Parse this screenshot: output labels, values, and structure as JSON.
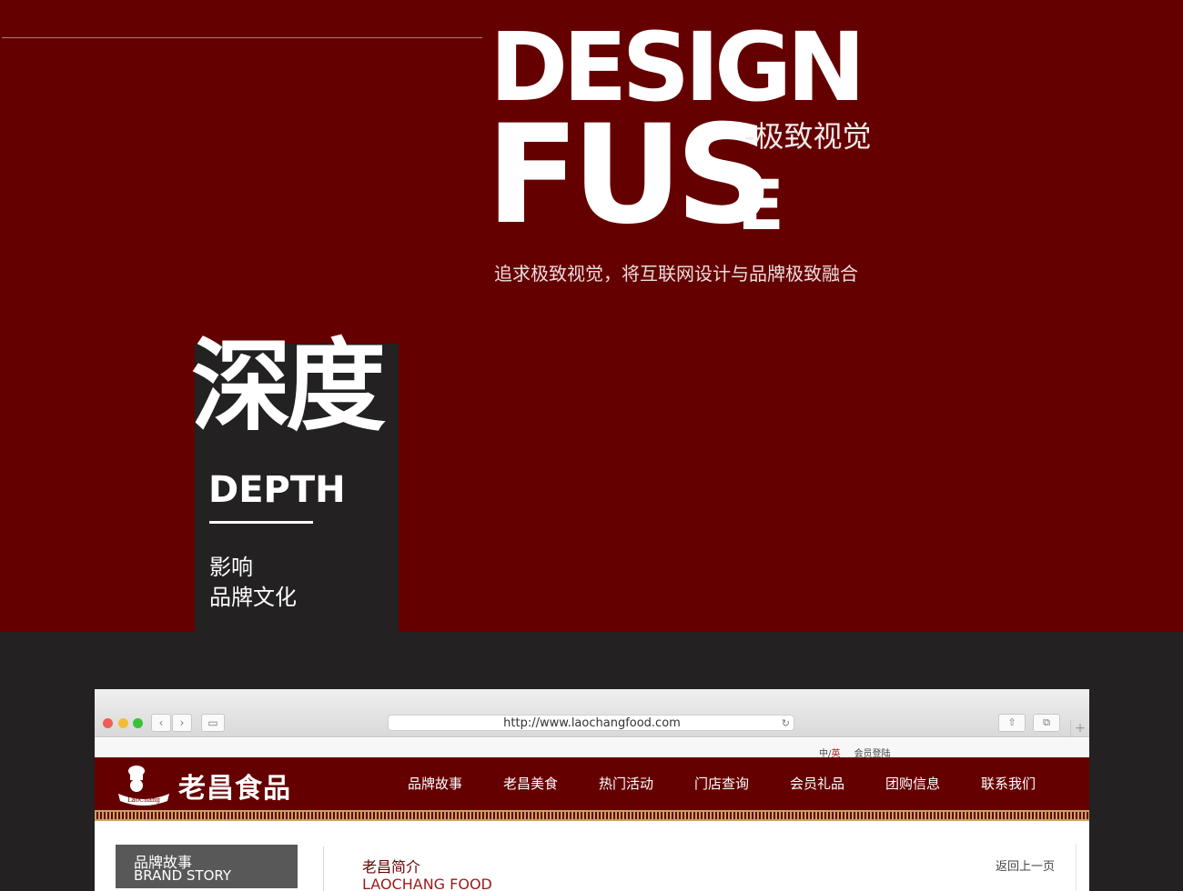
{
  "hero": {
    "title_line1": "DESIGN",
    "title_line2": "FUS",
    "title_last_letter": "E",
    "subtitle": "-极致视觉",
    "tagline": "追求极致视觉，将互联网设计与品牌极致融合"
  },
  "depth_card": {
    "cn_title": "深度",
    "en_title": "DEPTH",
    "line1": "影响",
    "line2": "品牌文化"
  },
  "browser": {
    "url": "http://www.laochangfood.com",
    "back_glyph": "‹",
    "forward_glyph": "›",
    "sidebar_glyph": "▭",
    "reload_glyph": "↻",
    "share_glyph": "⇧",
    "tabs_glyph": "⧉",
    "new_tab_glyph": "+"
  },
  "site": {
    "lang_cn": "中",
    "lang_sep": "/",
    "lang_en": "英",
    "small_link": "会员登陆",
    "logo_text": "老昌食品",
    "logo_badge": "LaoChang",
    "nav": [
      "品牌故事",
      "老昌美食",
      "热门活动",
      "门店查询",
      "会员礼品",
      "团购信息",
      "联系我们"
    ],
    "sidebar_cn": "品牌故事",
    "sidebar_en": "BRAND STORY",
    "content_title": "老昌简介",
    "content_subtitle": "LAOCHANG FOOD",
    "back_link": "返回上一页"
  },
  "colors": {
    "brand_red": "#650001",
    "dark_bg": "#232122",
    "gold": "#c9a165"
  }
}
